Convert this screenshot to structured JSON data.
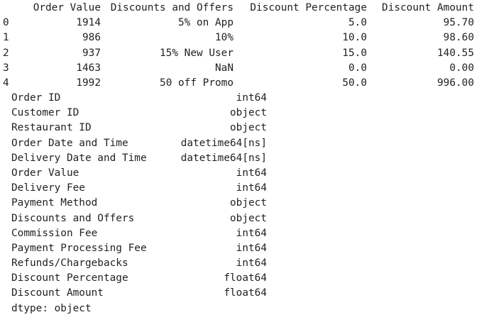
{
  "dataframe": {
    "columns": [
      "Order Value",
      "Discounts and Offers",
      "Discount Percentage",
      "Discount Amount"
    ],
    "rows": [
      {
        "index": "0",
        "order_value": "1914",
        "discounts": "5% on App",
        "discount_pct": "5.0",
        "discount_amt": "95.70"
      },
      {
        "index": "1",
        "order_value": "986",
        "discounts": "10%",
        "discount_pct": "10.0",
        "discount_amt": "98.60"
      },
      {
        "index": "2",
        "order_value": "937",
        "discounts": "15% New User",
        "discount_pct": "15.0",
        "discount_amt": "140.55"
      },
      {
        "index": "3",
        "order_value": "1463",
        "discounts": "NaN",
        "discount_pct": "0.0",
        "discount_amt": "0.00"
      },
      {
        "index": "4",
        "order_value": "1992",
        "discounts": "50 off Promo",
        "discount_pct": "50.0",
        "discount_amt": "996.00"
      }
    ]
  },
  "dtypes": {
    "rows": [
      {
        "name": "Order ID",
        "type": "int64"
      },
      {
        "name": "Customer ID",
        "type": "object"
      },
      {
        "name": "Restaurant ID",
        "type": "object"
      },
      {
        "name": "Order Date and Time",
        "type": "datetime64[ns]"
      },
      {
        "name": "Delivery Date and Time",
        "type": "datetime64[ns]"
      },
      {
        "name": "Order Value",
        "type": "int64"
      },
      {
        "name": "Delivery Fee",
        "type": "int64"
      },
      {
        "name": "Payment Method",
        "type": "object"
      },
      {
        "name": "Discounts and Offers",
        "type": "object"
      },
      {
        "name": "Commission Fee",
        "type": "int64"
      },
      {
        "name": "Payment Processing Fee",
        "type": "int64"
      },
      {
        "name": "Refunds/Chargebacks",
        "type": "int64"
      },
      {
        "name": "Discount Percentage",
        "type": "float64"
      },
      {
        "name": "Discount Amount",
        "type": "float64"
      }
    ],
    "footer": "dtype: object"
  }
}
